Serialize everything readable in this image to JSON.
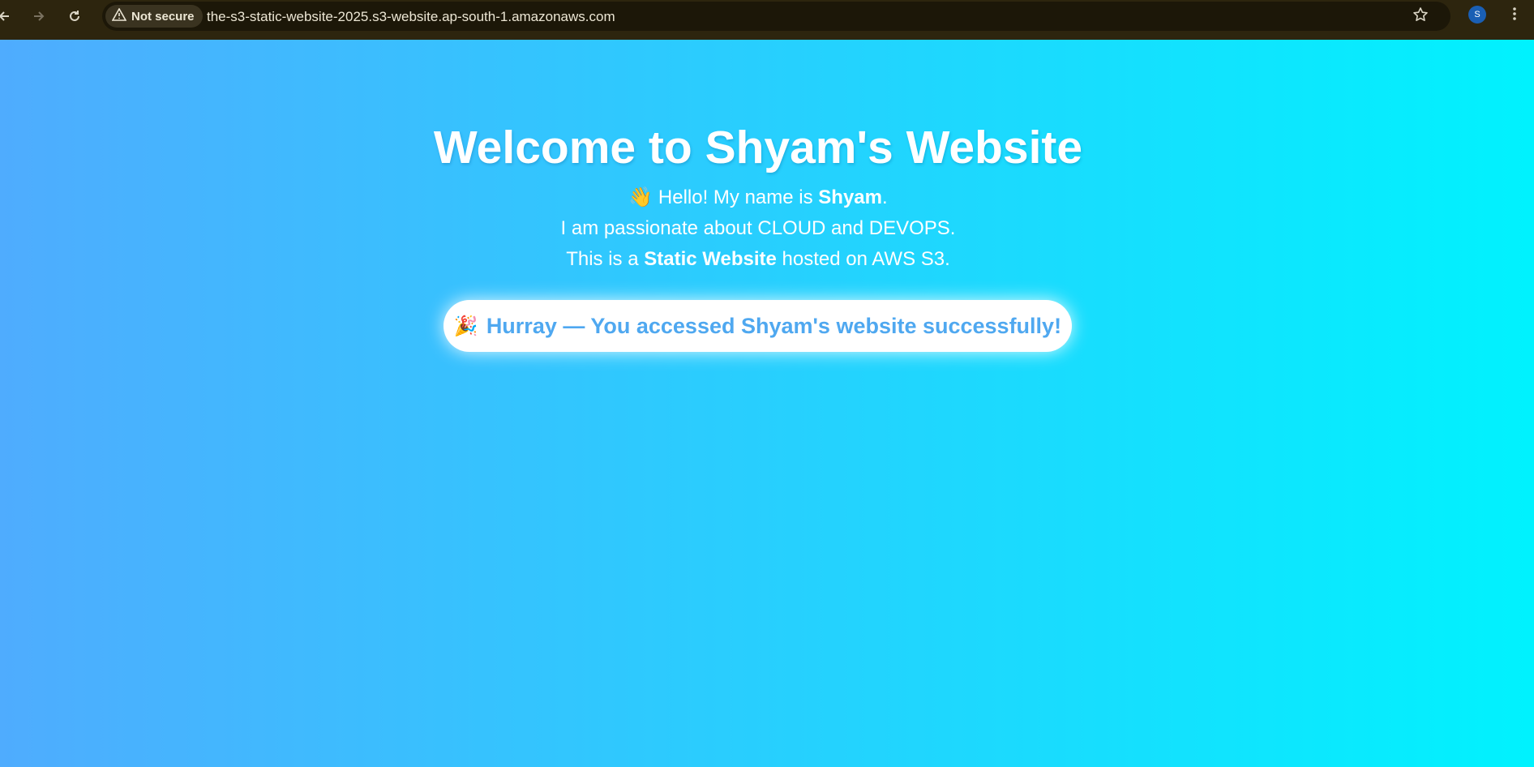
{
  "browser": {
    "security_label": "Not secure",
    "url": "the-s3-static-website-2025.s3-website.ap-south-1.amazonaws.com",
    "avatar_initial": "S",
    "icons": {
      "back": "back-arrow-icon",
      "forward": "forward-arrow-icon",
      "reload": "reload-icon",
      "warning": "warning-icon",
      "bookmark": "star-icon",
      "menu": "kebab-menu-icon"
    }
  },
  "page": {
    "title": "Welcome to Shyam's Website",
    "greeting": {
      "emoji": "👋",
      "prefix": " Hello! My name is ",
      "name": "Shyam",
      "suffix": "."
    },
    "passion_line": "I am passionate about CLOUD and DEVOPS.",
    "hosting": {
      "prefix": "This is a ",
      "bold": "Static Website",
      "suffix": " hosted on AWS S3."
    },
    "banner": {
      "emoji": "🎉",
      "text": "Hurray — You accessed Shyam's website successfully!"
    },
    "colors": {
      "gradient_start": "#4facfe",
      "gradient_end": "#00f2fe",
      "banner_text": "#4fa8f0"
    }
  }
}
